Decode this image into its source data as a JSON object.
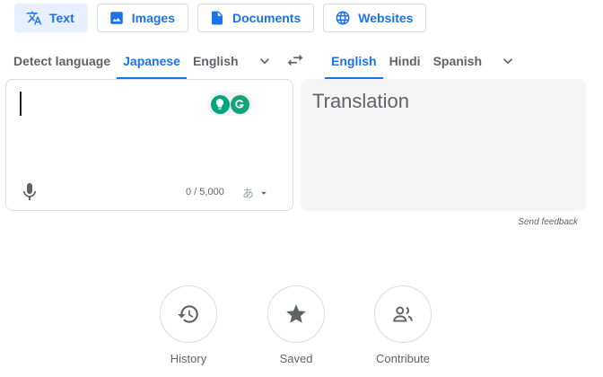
{
  "modes": [
    {
      "label": "Text",
      "icon": "translate-icon",
      "active": true
    },
    {
      "label": "Images",
      "icon": "image-icon",
      "active": false
    },
    {
      "label": "Documents",
      "icon": "document-icon",
      "active": false
    },
    {
      "label": "Websites",
      "icon": "globe-icon",
      "active": false
    }
  ],
  "source_languages": [
    "Detect language",
    "Japanese",
    "English"
  ],
  "source_active": "Japanese",
  "target_languages": [
    "English",
    "Hindi",
    "Spanish"
  ],
  "target_active": "English",
  "source": {
    "value": "",
    "char_count": "0 / 5,000",
    "ime_glyph": "あ"
  },
  "target": {
    "placeholder": "Translation"
  },
  "feedback": "Send feedback",
  "actions": [
    {
      "label": "History",
      "icon": "history-icon"
    },
    {
      "label": "Saved",
      "icon": "star-icon"
    },
    {
      "label": "Contribute",
      "icon": "people-icon"
    }
  ],
  "colors": {
    "accent": "#1a73e8",
    "text_muted": "#5f6368",
    "border": "#dadce0",
    "extension_teal": "#00a67e",
    "extension_grammarly": "#15c39a"
  }
}
